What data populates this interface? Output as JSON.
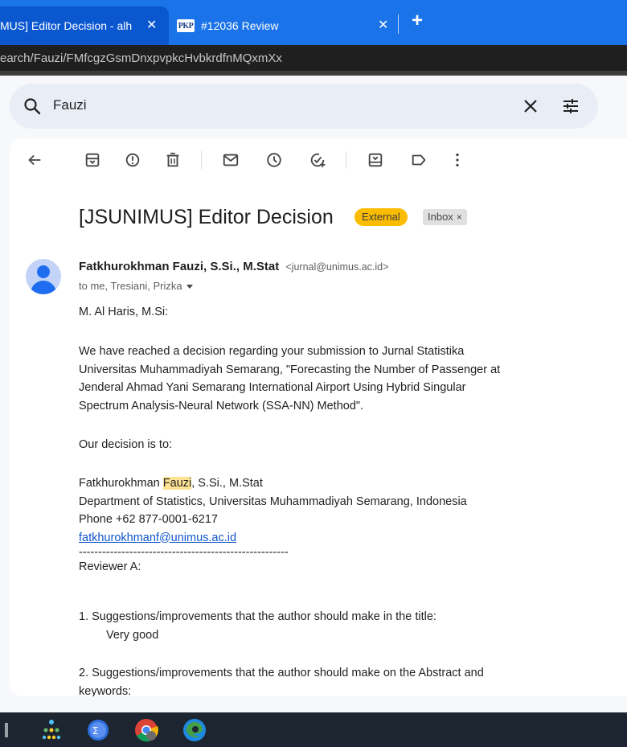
{
  "browser": {
    "tabs": [
      {
        "title": "MUS] Editor Decision - alh",
        "active": true
      },
      {
        "title": "#12036 Review",
        "icon": "PKP",
        "active": false
      }
    ],
    "new_tab_label": "+",
    "close_label": "✕",
    "address": "earch/Fauzi/FMfcgzGsmDnxpvpkcHvbkrdfnMQxmXx"
  },
  "search": {
    "query": "Fauzi",
    "icons": [
      "search-icon",
      "close-icon",
      "filter-sliders-icon"
    ]
  },
  "toolbar": {
    "icons": [
      "back-arrow-icon",
      "archive-icon",
      "report-spam-icon",
      "delete-icon",
      "mark-unread-icon",
      "snooze-icon",
      "add-task-icon",
      "move-to-icon",
      "label-icon",
      "more-vert-icon"
    ]
  },
  "email": {
    "subject": "[JSUNIMUS] Editor Decision",
    "badge_external": "External",
    "badge_inbox": "Inbox",
    "badge_inbox_close": "×",
    "sender_name": "Fatkhurokhman Fauzi, S.Si., M.Stat",
    "sender_email": "<jurnal@unimus.ac.id>",
    "to": "to me, Tresiani, Prizka",
    "greeting": "M. Al Haris, M.Si:",
    "paragraph": [
      "We have reached a decision regarding your submission to Jurnal Statistika",
      "Universitas Muhammadiyah Semarang, \"Forecasting the Number of Passenger at",
      "Jenderal Ahmad Yani Semarang International Airport Using Hybrid Singular",
      "Spectrum Analysis-Neural Network (SSA-NN) Method\"."
    ],
    "decision_line": "Our decision is to:",
    "signature": {
      "name_prefix": "Fatkhurokhman ",
      "name_highlight": "Fauzi",
      "name_suffix": ", S.Si., M.Stat",
      "department": "Department of Statistics, Universitas Muhammadiyah Semarang, Indonesia",
      "phone": "Phone +62 877-0001-6217",
      "email": "fatkhurokhmanf@unimus.ac.id"
    },
    "divider": "------------------------------------------------------",
    "reviewer": "Reviewer A:",
    "q1": "1. Suggestions/improvements that the author should make in the title:",
    "a1": "Very good",
    "q2_line1": "2. Suggestions/improvements that the author should make on the Abstract and",
    "q2_line2": "keywords:"
  },
  "taskbar": {
    "apps": [
      "widget-icon",
      "network-app-icon",
      "math-app-icon",
      "chrome-icon",
      "edge-icon"
    ]
  },
  "colors": {
    "tab_bar": "#1a73e8",
    "external_badge": "#fbbc04",
    "highlight": "#fde293",
    "link": "#1155cc"
  }
}
